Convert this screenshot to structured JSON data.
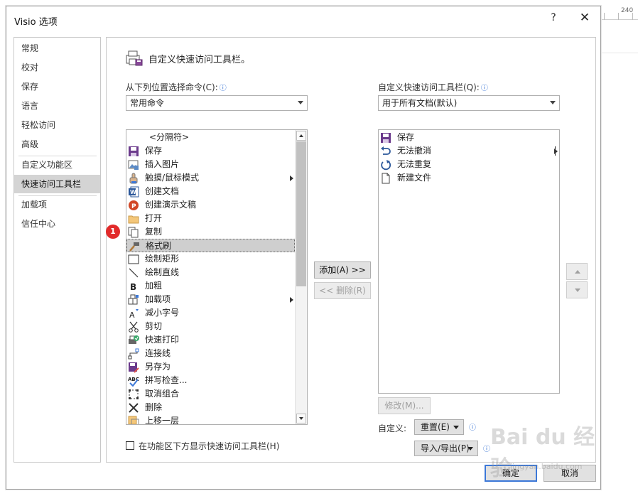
{
  "window": {
    "title": "Visio 选项",
    "help": "?",
    "close": "✕"
  },
  "ruler_label": "240",
  "nav": {
    "items": [
      {
        "label": "常规"
      },
      {
        "label": "校对"
      },
      {
        "label": "保存"
      },
      {
        "label": "语言"
      },
      {
        "label": "轻松访问"
      },
      {
        "label": "高级"
      },
      {
        "label": "自定义功能区"
      },
      {
        "label": "快速访问工具栏"
      },
      {
        "label": "加载项"
      },
      {
        "label": "信任中心"
      }
    ],
    "active": "快速访问工具栏"
  },
  "header": {
    "title": "自定义快速访问工具栏。"
  },
  "left": {
    "label": "从下列位置选择命令(C):",
    "combo_value": "常用命令",
    "items": [
      {
        "label": "<分隔符>",
        "icon": "separator"
      },
      {
        "label": "保存",
        "icon": "save-icon"
      },
      {
        "label": "插入图片",
        "icon": "picture-icon"
      },
      {
        "label": "触摸/鼠标模式",
        "icon": "touch-icon",
        "submenu": true
      },
      {
        "label": "创建文档",
        "icon": "word-icon"
      },
      {
        "label": "创建演示文稿",
        "icon": "powerpoint-icon"
      },
      {
        "label": "打开",
        "icon": "folder-icon"
      },
      {
        "label": "复制",
        "icon": "copy-icon"
      },
      {
        "label": "格式刷",
        "icon": "format-painter-icon",
        "selected": true
      },
      {
        "label": "绘制矩形",
        "icon": "rectangle-icon"
      },
      {
        "label": "绘制直线",
        "icon": "line-icon"
      },
      {
        "label": "加粗",
        "icon": "bold-icon"
      },
      {
        "label": "加载项",
        "icon": "addin-icon",
        "submenu": true
      },
      {
        "label": "减小字号",
        "icon": "font-decrease-icon"
      },
      {
        "label": "剪切",
        "icon": "scissors-icon"
      },
      {
        "label": "快速打印",
        "icon": "quick-print-icon"
      },
      {
        "label": "连接线",
        "icon": "connector-icon"
      },
      {
        "label": "另存为",
        "icon": "save-as-icon"
      },
      {
        "label": "拼写检查...",
        "icon": "spelling-icon"
      },
      {
        "label": "取消组合",
        "icon": "ungroup-icon"
      },
      {
        "label": "删除",
        "icon": "delete-icon"
      },
      {
        "label": "上移一层",
        "icon": "bring-forward-icon"
      }
    ]
  },
  "right": {
    "label": "自定义快速访问工具栏(Q):",
    "combo_value": "用于所有文档(默认)",
    "items": [
      {
        "label": "保存",
        "icon": "save-icon"
      },
      {
        "label": "无法撤消",
        "icon": "undo-icon"
      },
      {
        "label": "无法重复",
        "icon": "redo-icon"
      },
      {
        "label": "新建文件",
        "icon": "new-file-icon"
      }
    ]
  },
  "buttons": {
    "add": "添加(A) >>",
    "remove": "<< 删除(R)",
    "modify": "修改(M)...",
    "ok": "确定",
    "cancel": "取消"
  },
  "customize": {
    "label": "自定义:",
    "reset": "重置(E)",
    "import_export": "导入/导出(P)"
  },
  "checkbox": {
    "label": "在功能区下方显示快速访问工具栏(H)",
    "checked": false
  },
  "annotation": {
    "badge": "1"
  },
  "watermark": {
    "text": "Bai du 经验",
    "url": "jingyan.baidu.com"
  }
}
